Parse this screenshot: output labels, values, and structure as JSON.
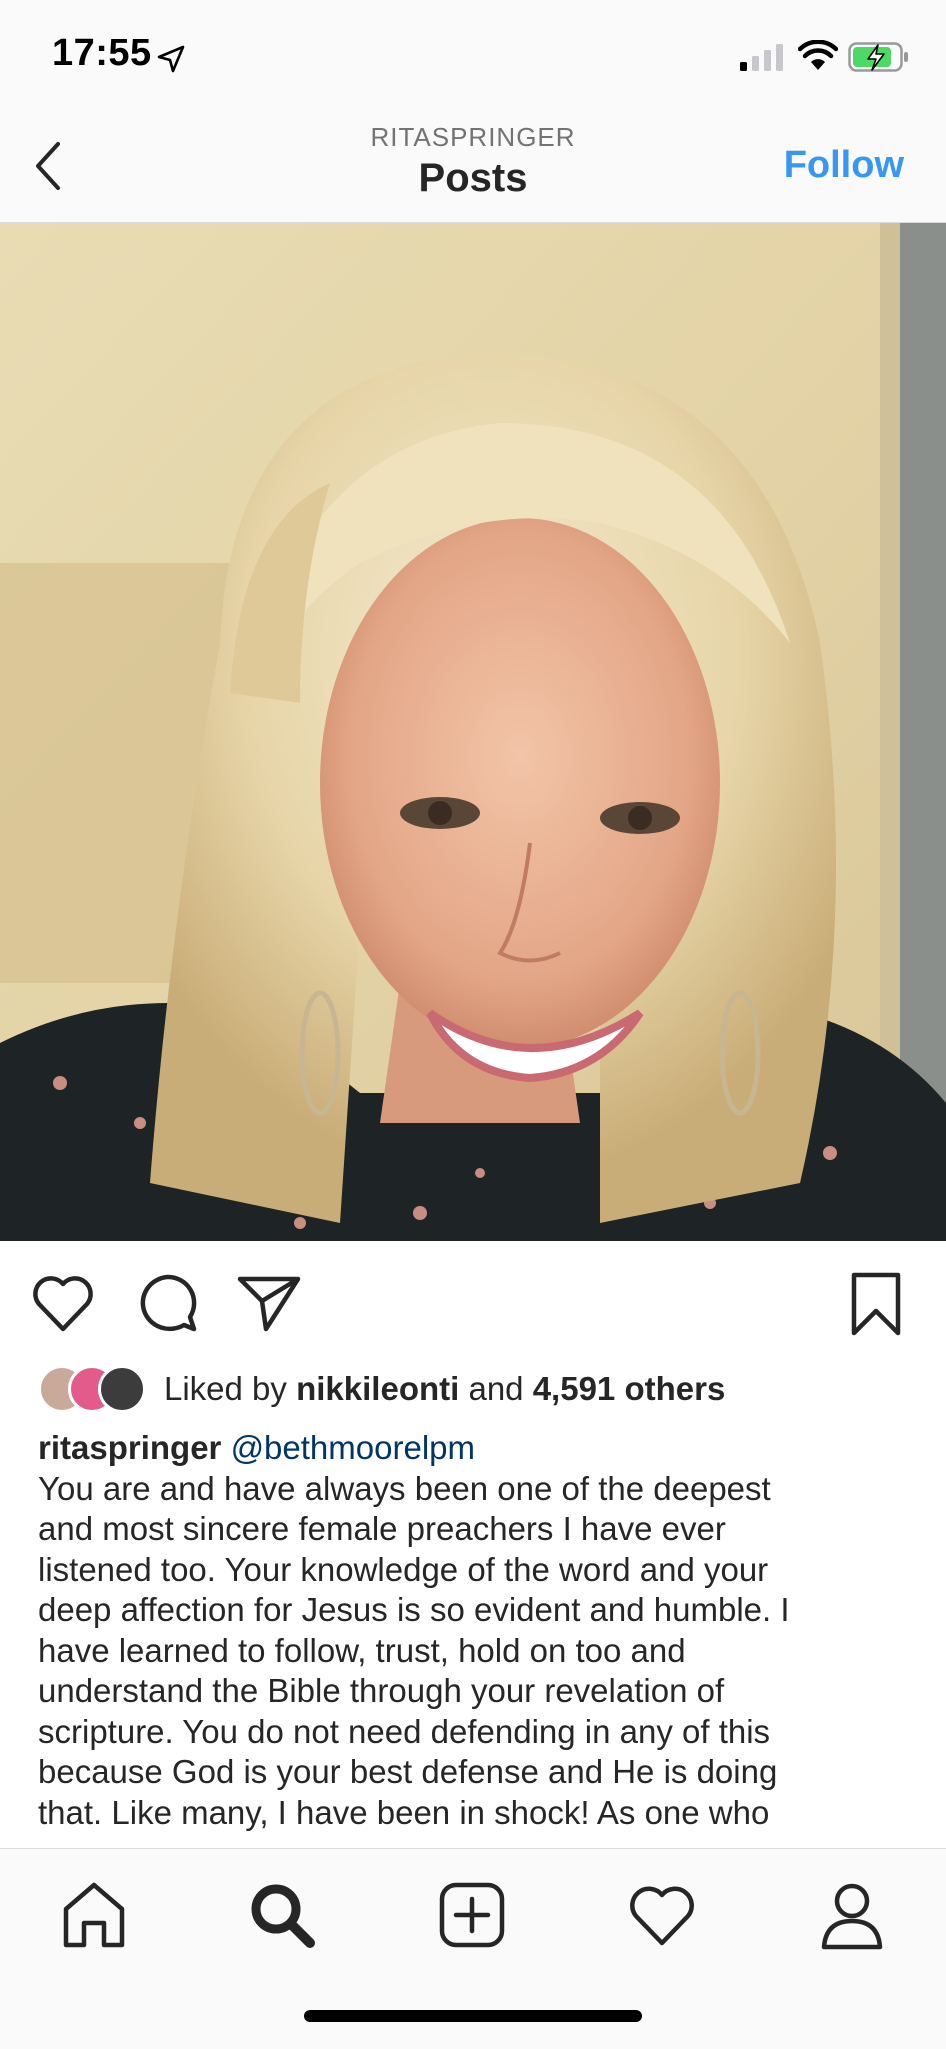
{
  "status_bar": {
    "time": "17:55"
  },
  "header": {
    "username": "RITASPRINGER",
    "title": "Posts",
    "follow_label": "Follow"
  },
  "post": {
    "likes": {
      "prefix": "Liked by ",
      "user": "nikkileonti",
      "middle": " and ",
      "count": "4,591 others"
    },
    "caption": {
      "username": "ritaspringer",
      "mention": "@bethmoorelpm",
      "text": "You are and have always been one of the deepest\nand most sincere female preachers I have ever\nlistened too.  Your knowledge of the word and your\ndeep affection for Jesus is so evident and humble.  I\nhave learned to follow, trust, hold on too and\nunderstand the Bible through your revelation of\nscripture.  You do not need defending in any of this\nbecause God is your best defense and He is doing\nthat.  Like many, I have been in shock!  As one who"
    }
  },
  "colors": {
    "accent": "#3897f0",
    "mention": "#003569",
    "text": "#262626"
  },
  "icons": {
    "back": "chevron-left-icon",
    "like": "heart-icon",
    "comment": "comment-bubble-icon",
    "share": "paper-plane-icon",
    "save": "bookmark-icon",
    "tabs": [
      "home-icon",
      "search-icon",
      "add-post-icon",
      "activity-heart-icon",
      "profile-icon"
    ]
  }
}
